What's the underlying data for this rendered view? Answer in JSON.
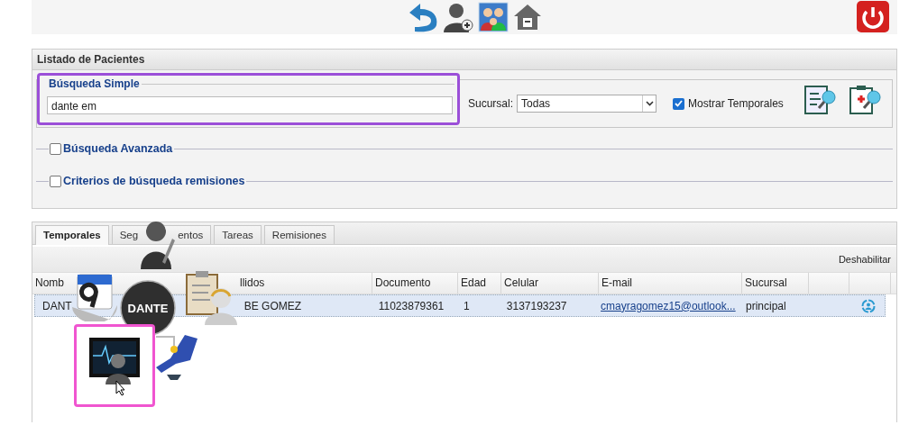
{
  "panel": {
    "title": "Listado de Pacientes"
  },
  "simple_search": {
    "legend": "Búsqueda Simple",
    "value": "dante em",
    "branch_label": "Sucursal:",
    "branch_value": "Todas",
    "show_temp_label": "Mostrar Temporales",
    "show_temp_checked": true
  },
  "sections": [
    {
      "label": "Búsqueda Avanzada",
      "checked": false
    },
    {
      "label": "Criterios de búsqueda remisiones",
      "checked": false
    }
  ],
  "tabs": [
    {
      "label": "Temporales",
      "selected": true
    },
    {
      "label_start": "Seg",
      "label_end": "entos",
      "selected": false
    },
    {
      "label": "Tareas",
      "selected": false
    },
    {
      "label": "Remisiones",
      "selected": false
    }
  ],
  "grid_action": "Deshabilitar",
  "columns": [
    "Nomb",
    "llidos",
    "Documento",
    "Edad",
    "Celular",
    "E-mail",
    "Sucursal"
  ],
  "rows": [
    {
      "cells": [
        "DANT",
        "BE GOMEZ",
        "11023879361",
        "1",
        "3137193237",
        "cmayragomez15@outlook...",
        "principal"
      ],
      "selected": true
    }
  ],
  "radial_menu": {
    "center_label": "DANTE"
  }
}
